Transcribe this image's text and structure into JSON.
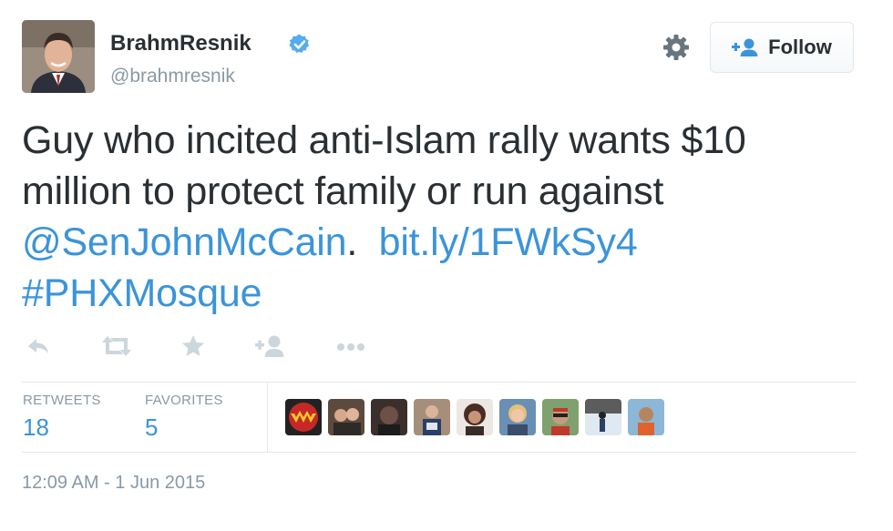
{
  "user": {
    "display_name": "BrahmResnik",
    "handle": "@brahmresnik",
    "verified": true
  },
  "header": {
    "settings_icon": "gear-icon",
    "follow_label": "Follow",
    "follow_icon": "add-user-icon"
  },
  "tweet": {
    "text_line1": "Guy who incited anti-Islam rally wants $10",
    "text_line2": "million to protect family or run against",
    "mention": "@SenJohnMcCain",
    "after_mention": ".",
    "link": "bit.ly/1FWkSy4",
    "hashtag": "#PHXMosque"
  },
  "actions": [
    "reply-icon",
    "retweet-icon",
    "favorite-icon",
    "follow-icon",
    "more-icon"
  ],
  "stats": {
    "retweets_label": "RETWEETS",
    "retweets_count": "18",
    "favorites_label": "FAVORITES",
    "favorites_count": "5"
  },
  "favoriters_count_shown": 9,
  "timestamp": "12:09 AM - 1 Jun 2015",
  "colors": {
    "link": "#3b94d9",
    "muted": "#8899a6",
    "text": "#292f33",
    "verified": "#55acee",
    "border": "#e1e8ed"
  }
}
